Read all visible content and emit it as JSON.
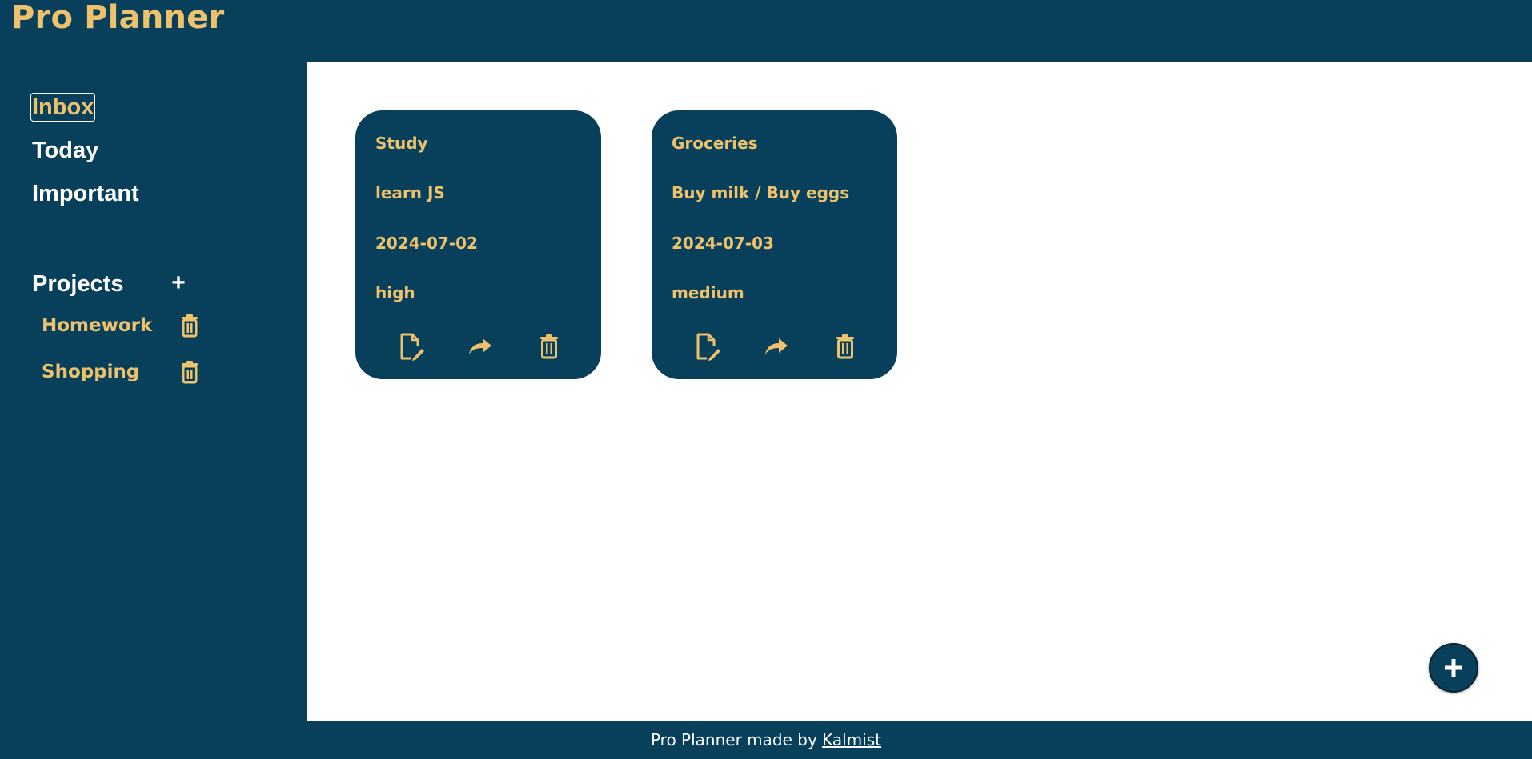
{
  "app": {
    "title": "Pro Planner"
  },
  "sidebar": {
    "nav": [
      {
        "label": "Inbox",
        "active": true
      },
      {
        "label": "Today",
        "active": false
      },
      {
        "label": "Important",
        "active": false
      }
    ],
    "projects_title": "Projects",
    "add_project_label": "+",
    "projects": [
      {
        "name": "Homework",
        "icon": "trash-icon"
      },
      {
        "name": "Shopping",
        "icon": "trash-icon"
      }
    ]
  },
  "tasks": [
    {
      "project": "Study",
      "description": "learn JS",
      "date": "2024-07-02",
      "priority": "high"
    },
    {
      "project": "Groceries",
      "description": "Buy milk / Buy eggs",
      "date": "2024-07-03",
      "priority": "medium"
    }
  ],
  "card_actions": [
    "edit-icon",
    "share-icon",
    "trash-icon"
  ],
  "fab": {
    "label": "+",
    "icon": "plus-icon"
  },
  "footer": {
    "text": "Pro Planner made by ",
    "link_text": "Kalmist"
  },
  "colors": {
    "primary": "#08405b",
    "accent": "#eec26d",
    "text": "#ffffff",
    "surface": "#ffffff"
  }
}
